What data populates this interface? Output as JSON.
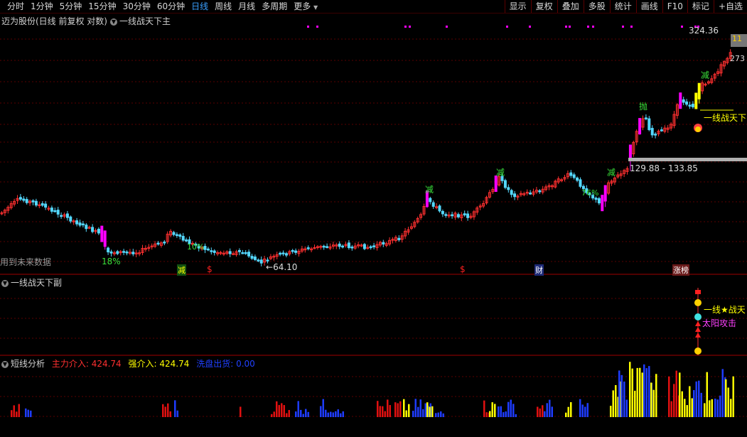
{
  "toolbar": {
    "periods": [
      "分时",
      "1分钟",
      "5分钟",
      "15分钟",
      "30分钟",
      "60分钟",
      "日线",
      "周线",
      "月线",
      "多周期",
      "更多"
    ],
    "active": "日线",
    "more_arrow": "▼",
    "buttons": [
      "显示",
      "复权",
      "叠加",
      "多股",
      "统计",
      "画线",
      "F10",
      "标记",
      "+自选"
    ]
  },
  "main_pane": {
    "stock_title": "迈为股份(日线 前复权 对数)",
    "indicator_name": "一线战天下主",
    "price_high": "324.36",
    "price_right_1": "11",
    "price_right_2": "273",
    "range_label": "129.88 - 133.85",
    "low_label": "64.10",
    "pct_label_1": "18%",
    "pct_label_2": "10%",
    "pct_label_3": "76%",
    "future_data_label": "用到未来数据",
    "signal_text": "一线战天下",
    "marker_jian": "减",
    "marker_pao": "抛",
    "marker_dollar": "$",
    "marker_cai": "财",
    "marker_zhangting": "涨榜",
    "money_bag": "$"
  },
  "sub_pane": {
    "title": "一线战天下副",
    "label_1": "一线★战天",
    "label_2": "太阳攻击",
    "money_bag": "$"
  },
  "volume_pane": {
    "title": "短线分析",
    "main_in_label": "主力介入: 424.74",
    "strong_in_label": "强介入: 424.74",
    "exit_label": "洗盘出货: 0.00"
  },
  "colors": {
    "up": "#ff3030",
    "down": "#54d8ff",
    "magenta": "#ff00ff",
    "yellow": "#ffff00",
    "blue": "#1e3cff",
    "red_vol": "#e01010",
    "grid": "#5a0000"
  },
  "chart_data": {
    "type": "candlestick",
    "price_scale": "log",
    "y_labels": [
      "324.36",
      "273",
      "129.88",
      "133.85",
      "64.10"
    ],
    "volume_series": [
      {
        "name": "主力介入",
        "last": 424.74
      },
      {
        "name": "强介入",
        "last": 424.74
      },
      {
        "name": "洗盘出货",
        "last": 0.0
      }
    ]
  }
}
